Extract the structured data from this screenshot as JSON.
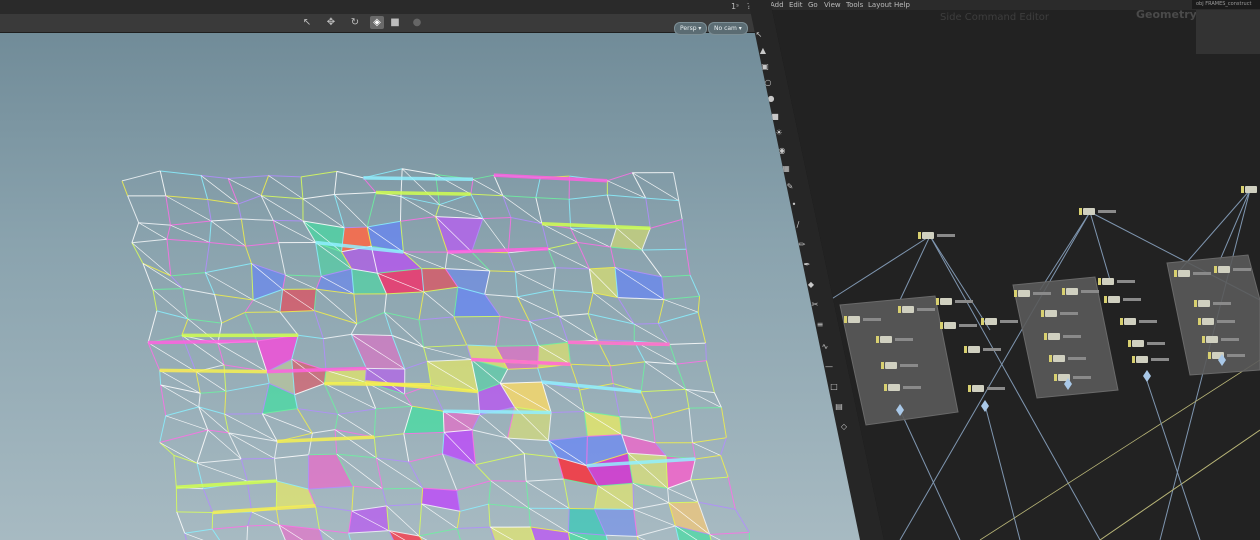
{
  "viewport": {
    "toolbar_tools": [
      "select-tool",
      "move-tool",
      "rotate-tool",
      "snap-tool",
      "display-tool",
      "render-tool"
    ],
    "persp_label": "Persp ▾",
    "cam_label": "No cam ▾",
    "top_right_tools": [
      "1ˢ",
      "?"
    ]
  },
  "network": {
    "menu": [
      "Add",
      "Edit",
      "Go",
      "View",
      "Tools",
      "Layout",
      "Help"
    ],
    "editor_title": "Side Command Editor",
    "context_label": "Geometry",
    "path": "obj FRAMES_construct"
  },
  "colors": {
    "viewport_bg": "#8aa3ae",
    "network_bg": "#222222",
    "wire_line": "#7f96b0",
    "subnet_box": "#5a5a5a",
    "node": "#d0d0c0",
    "node_flag": "#d8d070"
  }
}
